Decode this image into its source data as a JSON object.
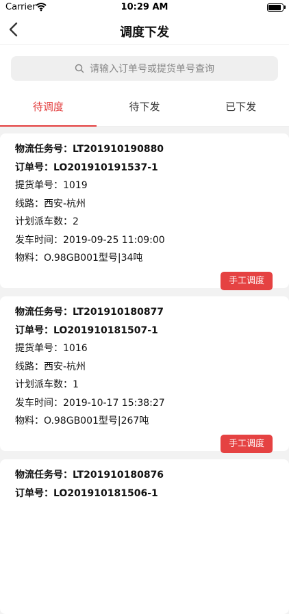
{
  "status": {
    "carrier": "Carrier",
    "time": "10:29 AM"
  },
  "nav": {
    "title": "调度下发"
  },
  "search": {
    "placeholder": "请输入订单号或提货单号查询"
  },
  "tabs": [
    {
      "label": "待调度",
      "active": true
    },
    {
      "label": "待下发",
      "active": false
    },
    {
      "label": "已下发",
      "active": false
    }
  ],
  "cards": [
    {
      "task": "物流任务号：LT201910190880",
      "order": "订单号：LO201910191537-1",
      "pickup": "提货单号：1019",
      "route": "线路：西安-杭州",
      "plan": "计划派车数：2",
      "depart": "发车时间：2019-09-25 11:09:00",
      "material": "物料：O.98GB001型号|34吨",
      "button": "手工调度"
    },
    {
      "task": "物流任务号：LT201910180877",
      "order": "订单号：LO201910181507-1",
      "pickup": "提货单号：1016",
      "route": "线路：西安-杭州",
      "plan": "计划派车数：1",
      "depart": "发车时间：2019-10-17 15:38:27",
      "material": "物料：O.98GB001型号|267吨",
      "button": "手工调度"
    },
    {
      "task": "物流任务号：LT201910180876",
      "order": "订单号：LO201910181506-1"
    }
  ]
}
